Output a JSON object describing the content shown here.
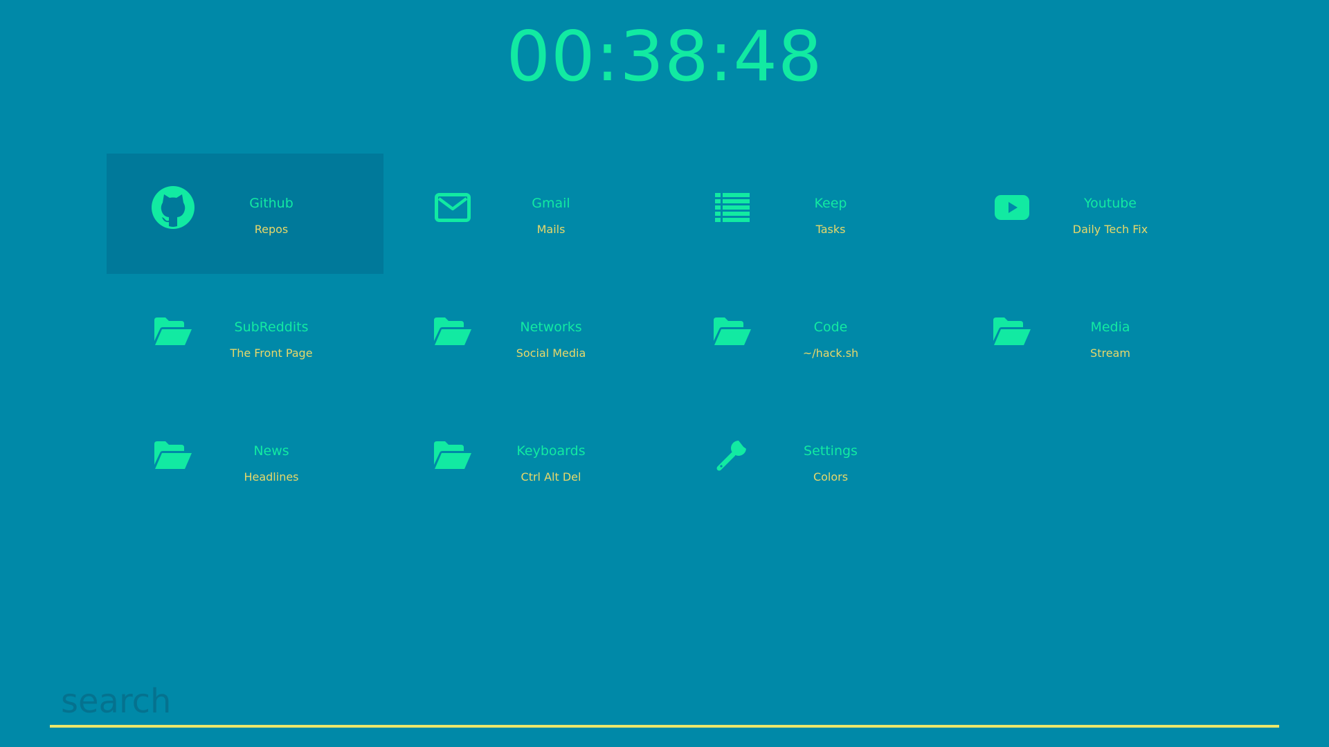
{
  "clock": {
    "time": "00:38:48"
  },
  "tiles": [
    {
      "title": "Github",
      "subtitle": "Repos",
      "icon": "github-icon",
      "active": true
    },
    {
      "title": "Gmail",
      "subtitle": "Mails",
      "icon": "envelope-icon"
    },
    {
      "title": "Keep",
      "subtitle": "Tasks",
      "icon": "list-icon"
    },
    {
      "title": "Youtube",
      "subtitle": "Daily Tech Fix",
      "icon": "youtube-icon"
    },
    {
      "title": "SubReddits",
      "subtitle": "The Front Page",
      "icon": "folder-open-icon"
    },
    {
      "title": "Networks",
      "subtitle": "Social Media",
      "icon": "folder-open-icon"
    },
    {
      "title": "Code",
      "subtitle": "~/hack.sh",
      "icon": "folder-open-icon"
    },
    {
      "title": "Media",
      "subtitle": "Stream",
      "icon": "folder-open-icon"
    },
    {
      "title": "News",
      "subtitle": "Headlines",
      "icon": "folder-open-icon"
    },
    {
      "title": "Keyboards",
      "subtitle": "Ctrl Alt Del",
      "icon": "folder-open-icon"
    },
    {
      "title": "Settings",
      "subtitle": "Colors",
      "icon": "wrench-icon"
    }
  ],
  "search": {
    "placeholder": "search",
    "value": ""
  },
  "colors": {
    "background": "#0089a8",
    "active_tile": "#00799a",
    "accent": "#12eaa2",
    "subtitle": "#e8d86a",
    "search_underline": "#ece66a",
    "search_placeholder": "#05728f"
  }
}
